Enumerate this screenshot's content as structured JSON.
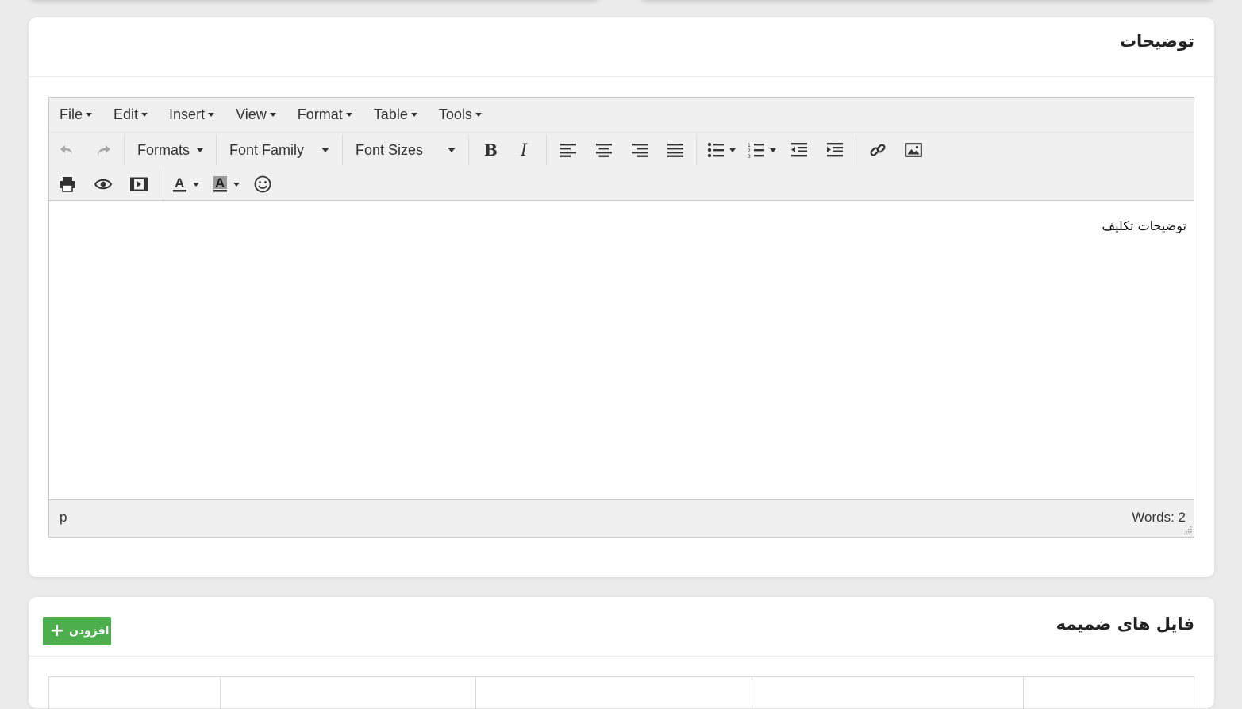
{
  "description_section": {
    "title": "توضیحات"
  },
  "editor": {
    "menu": [
      {
        "label": "File"
      },
      {
        "label": "Edit"
      },
      {
        "label": "Insert"
      },
      {
        "label": "View"
      },
      {
        "label": "Format"
      },
      {
        "label": "Table"
      },
      {
        "label": "Tools"
      }
    ],
    "formats_label": "Formats",
    "font_family_label": "Font Family",
    "font_sizes_label": "Font Sizes",
    "content_text": "توضیحات تکلیف",
    "status_path": "p",
    "word_count": "Words: 2",
    "icon_color": "#333333"
  },
  "attachments_section": {
    "title": "فایل های ضمیمه",
    "add_button_label": "افزودن",
    "add_button_color": "#4cae4c"
  }
}
